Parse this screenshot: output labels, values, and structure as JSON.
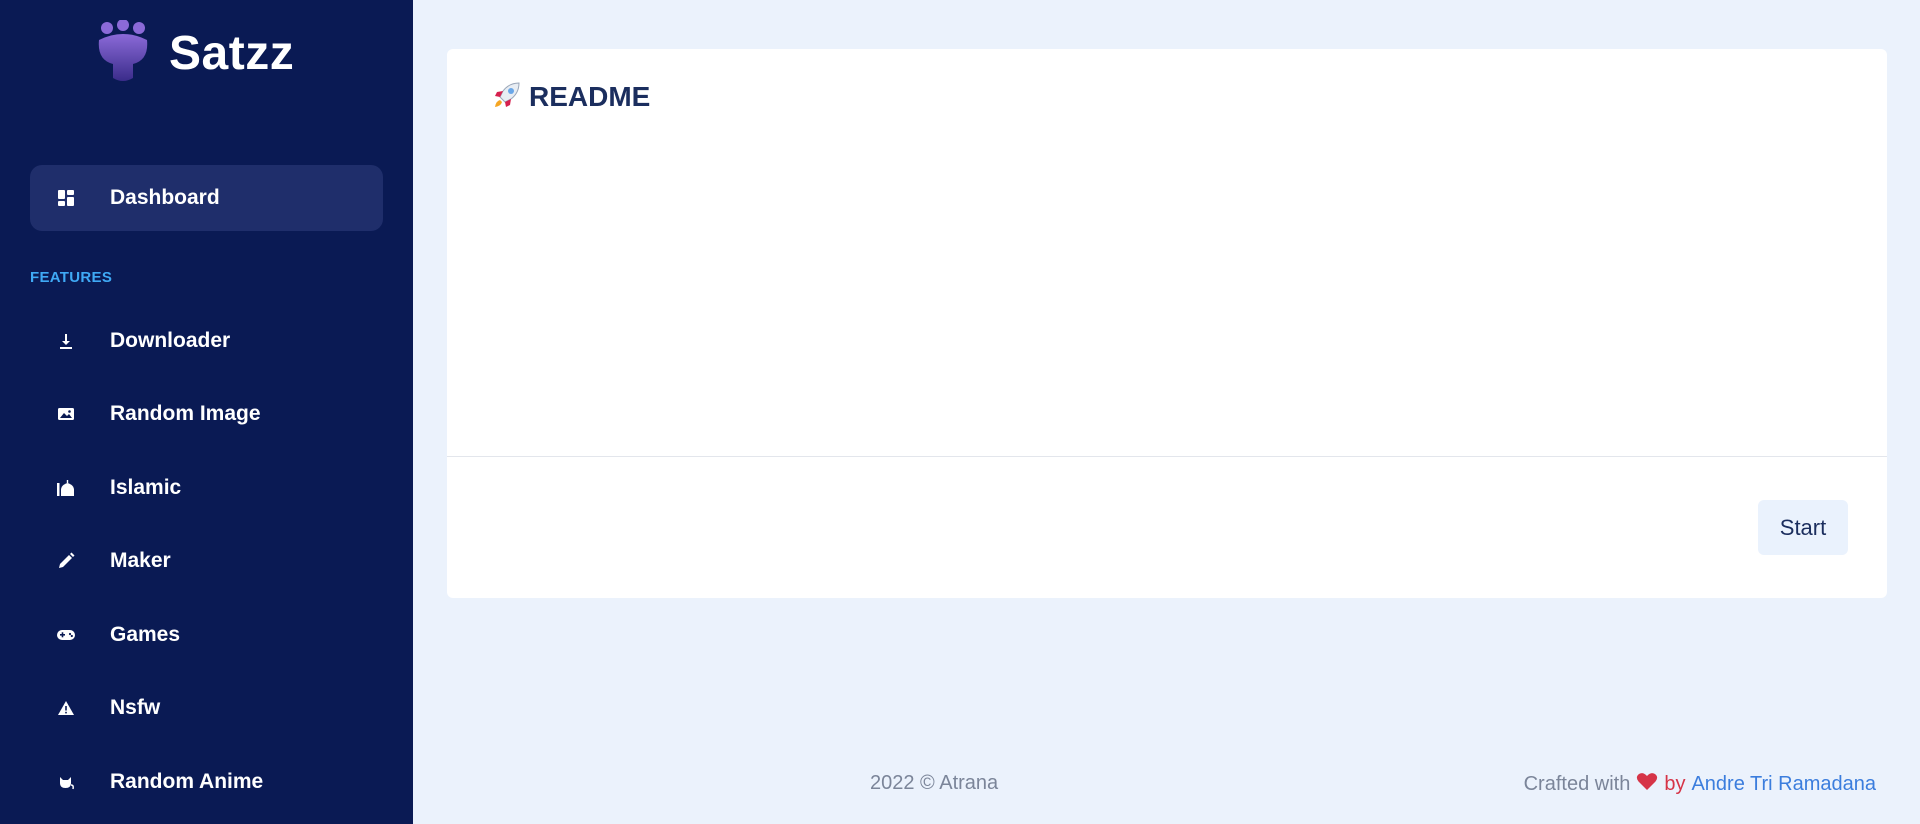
{
  "brand": {
    "name": "Satzz",
    "logo_icon": "paw-logo-icon"
  },
  "sidebar": {
    "active_item": {
      "label": "Dashboard",
      "icon": "dashboard-icon"
    },
    "section_title": "FEATURES",
    "items": [
      {
        "label": "Downloader",
        "icon": "download-icon"
      },
      {
        "label": "Random Image",
        "icon": "image-icon"
      },
      {
        "label": "Islamic",
        "icon": "mosque-icon"
      },
      {
        "label": "Maker",
        "icon": "pencil-icon"
      },
      {
        "label": "Games",
        "icon": "gamepad-icon"
      },
      {
        "label": "Nsfw",
        "icon": "warning-icon"
      },
      {
        "label": "Random Anime",
        "icon": "cat-icon"
      }
    ]
  },
  "main": {
    "card": {
      "title": "README",
      "title_icon": "rocket-icon",
      "start_label": "Start"
    }
  },
  "footer": {
    "copyright": "2022 © Atrana",
    "crafted_prefix": "Crafted with",
    "crafted_by": "by",
    "author": "Andre Tri Ramadana",
    "heart_color": "#d63447",
    "link_color": "#3b7ddd"
  },
  "colors": {
    "sidebar_bg": "#0a1a54",
    "active_item_bg": "#1f2e6b",
    "section_title": "#3fa9f5",
    "page_bg": "#ebf2fc"
  }
}
